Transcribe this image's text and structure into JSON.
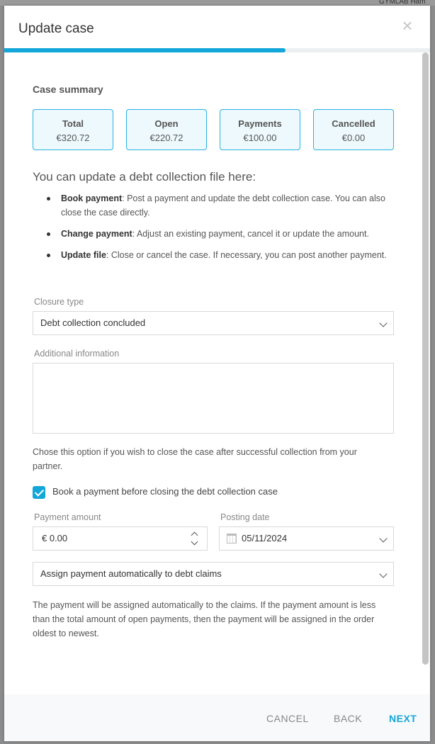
{
  "background": {
    "top_right_text": "GYMLAB Ham"
  },
  "modal": {
    "title": "Update case",
    "progress_fraction": 0.66,
    "summary": {
      "title": "Case summary",
      "cards": [
        {
          "label": "Total",
          "value": "€320.72"
        },
        {
          "label": "Open",
          "value": "€220.72"
        },
        {
          "label": "Payments",
          "value": "€100.00"
        },
        {
          "label": "Cancelled",
          "value": "€0.00"
        }
      ]
    },
    "intro": "You can update a debt collection file here:",
    "bullets": [
      {
        "term": "Book payment",
        "text": ": Post a payment and update the debt collection case. You can also close the case directly."
      },
      {
        "term": "Change payment",
        "text": ": Adjust an existing payment, cancel it or update the amount."
      },
      {
        "term": "Update file",
        "text": ": Close or cancel the case. If necessary, you can post another payment."
      }
    ],
    "closure_type": {
      "label": "Closure type",
      "value": "Debt collection concluded"
    },
    "additional_info": {
      "label": "Additional information",
      "value": ""
    },
    "closure_hint": "Chose this option if you wish to close the case after successful collection from your partner.",
    "book_payment": {
      "label": "Book a payment before closing the debt collection case",
      "checked": true
    },
    "payment_amount": {
      "label": "Payment amount",
      "value": "€ 0.00"
    },
    "posting_date": {
      "label": "Posting date",
      "value": "05/11/2024"
    },
    "assignment": {
      "value": "Assign payment automatically to debt claims"
    },
    "assignment_hint": "The payment will be assigned automatically to the claims. If the payment amount is less than the total amount of open payments, then the payment will be assigned in the order oldest to newest.",
    "footer": {
      "cancel": "CANCEL",
      "back": "BACK",
      "next": "NEXT"
    }
  },
  "colors": {
    "accent": "#13a6d9",
    "card_bg": "#eef9fd",
    "card_border": "#27b3e0"
  }
}
